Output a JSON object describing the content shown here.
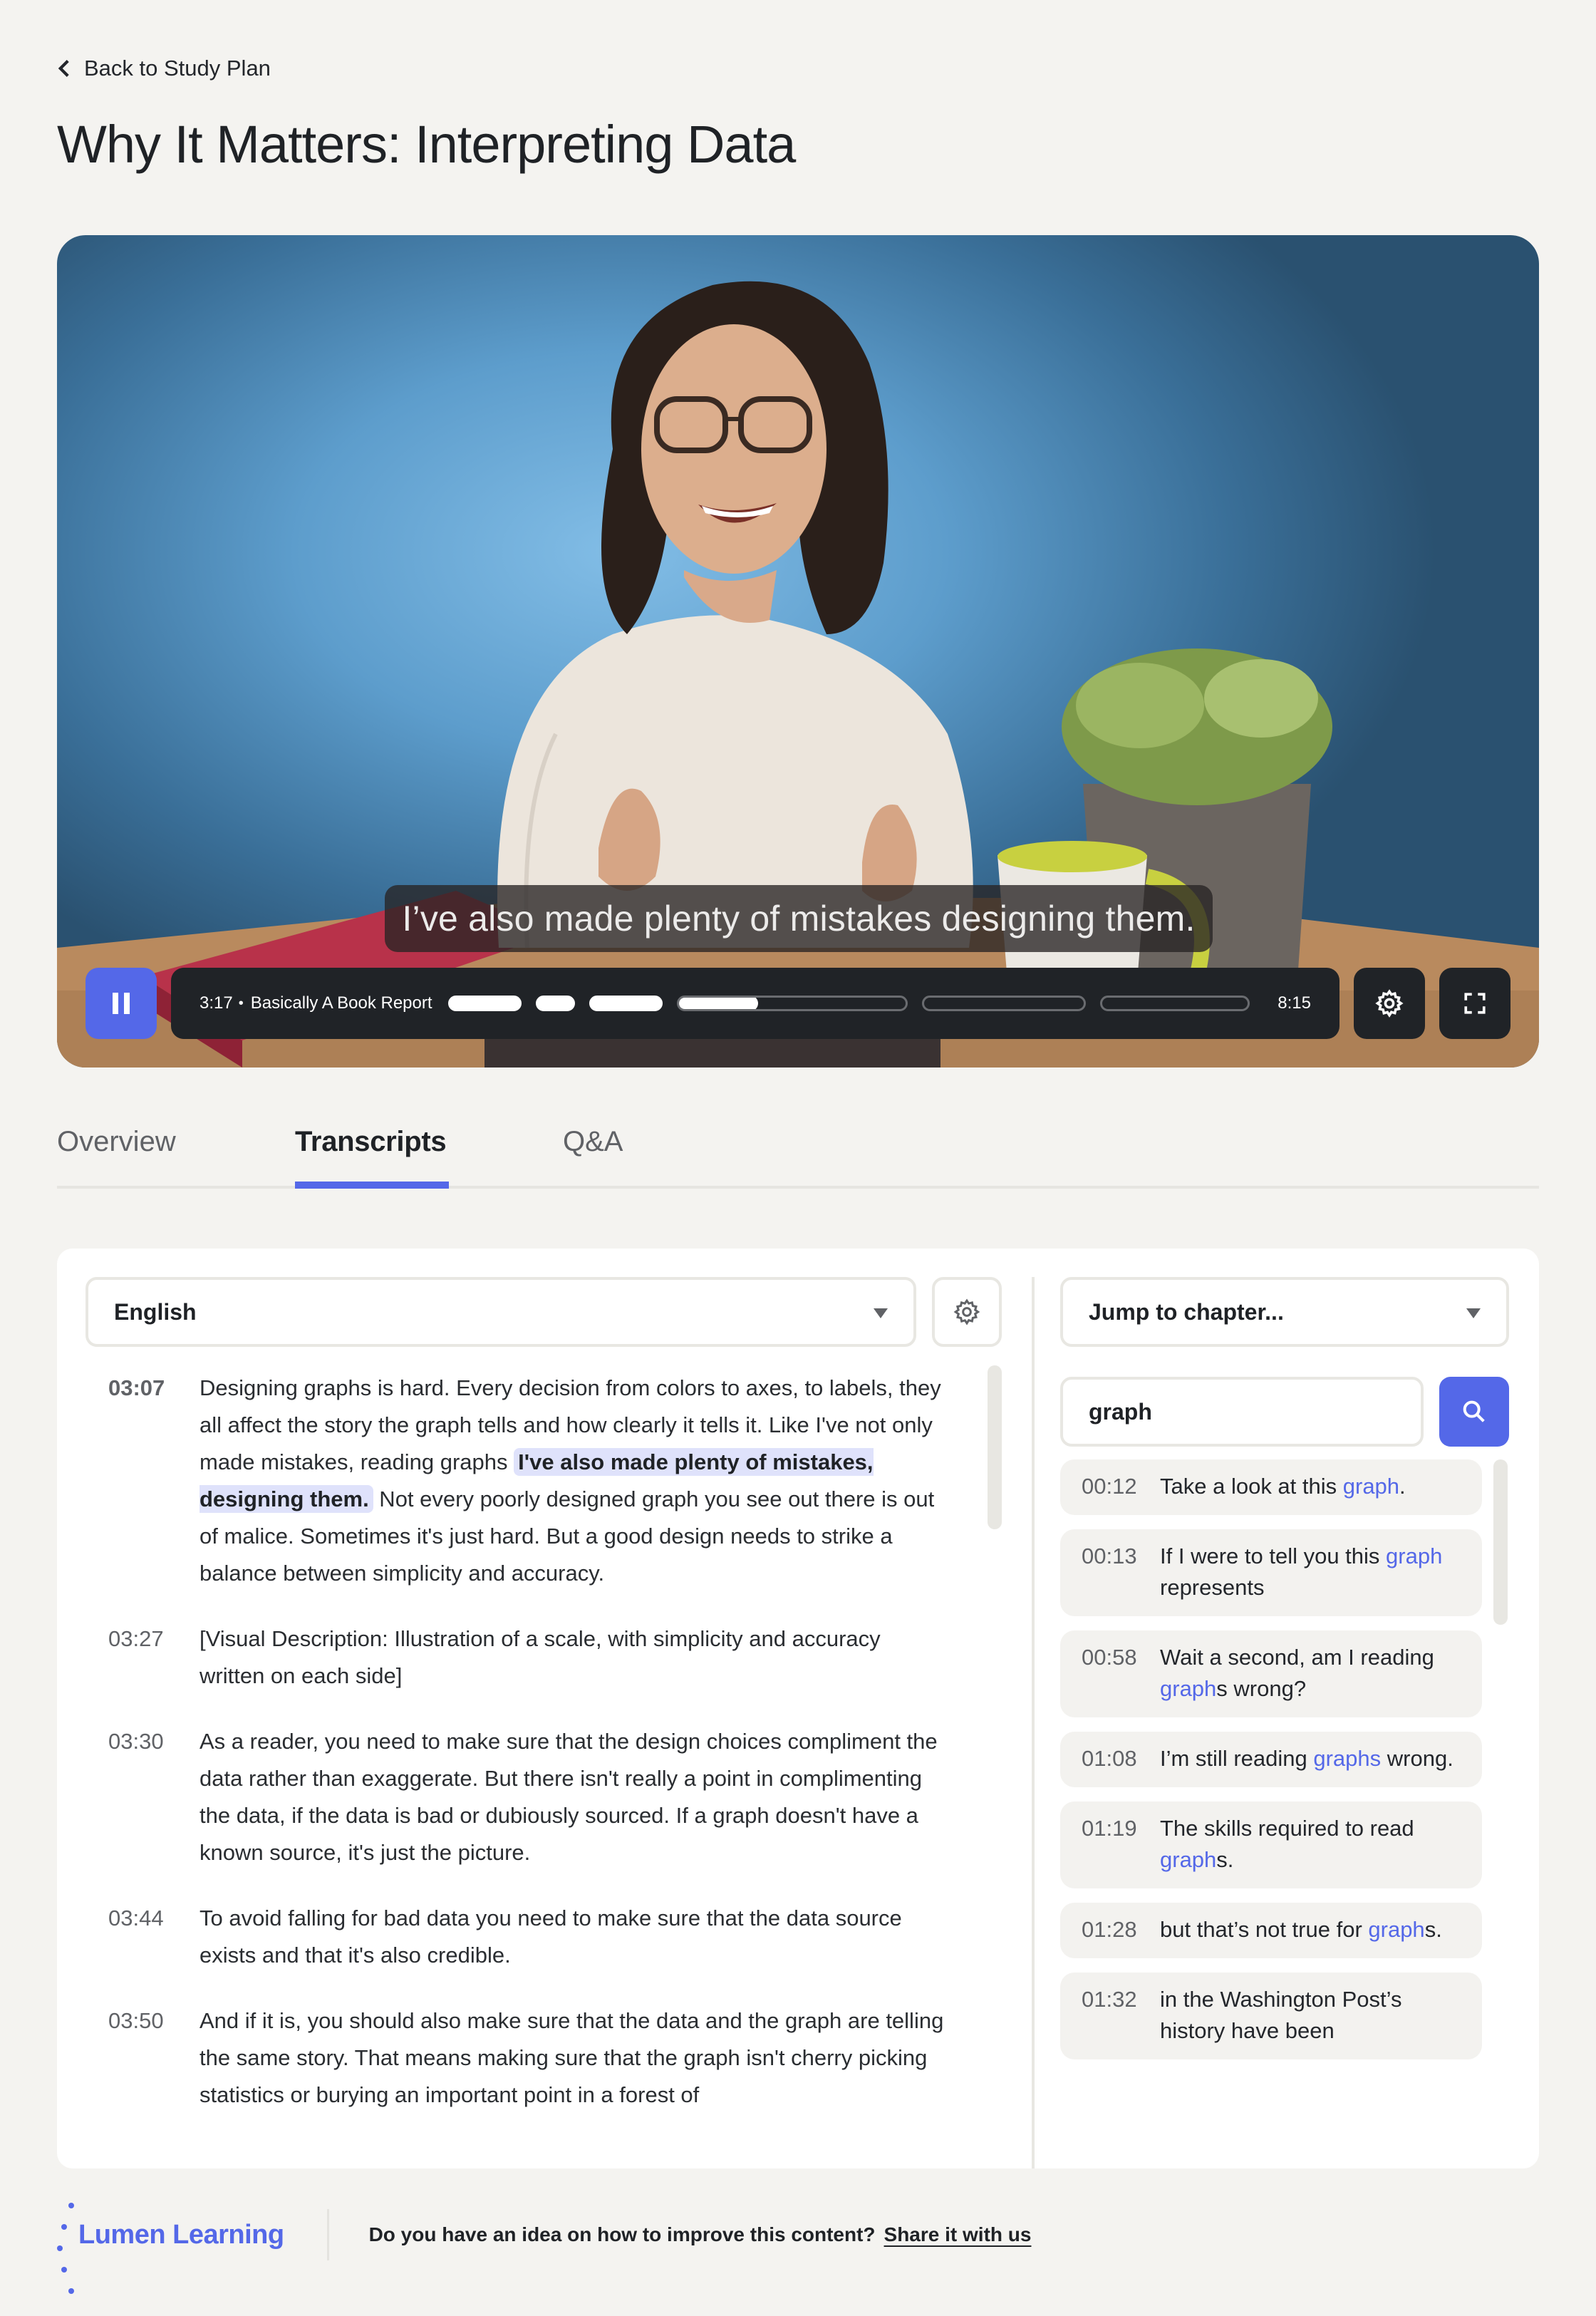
{
  "nav": {
    "back_label": "Back to Study Plan"
  },
  "page": {
    "title": "Why It Matters: Interpreting Data"
  },
  "video": {
    "caption": "I’ve also made plenty of mistakes designing them.",
    "current_time": "3:17",
    "separator": "•",
    "current_chapter": "Basically A Book Report",
    "duration": "8:15",
    "state": "playing",
    "chapters_progress": [
      1,
      1,
      1,
      0.35,
      0,
      0,
      0
    ],
    "icons": {
      "pause": "pause-icon",
      "settings": "gear-icon",
      "fullscreen": "fullscreen-icon"
    }
  },
  "tabs": [
    {
      "label": "Overview",
      "active": false
    },
    {
      "label": "Transcripts",
      "active": true
    },
    {
      "label": "Q&A",
      "active": false
    }
  ],
  "transcript": {
    "language": "English",
    "entries": [
      {
        "time": "03:07",
        "current": true,
        "before": "Designing graphs is hard. Every decision from colors to axes, to labels, they all affect the story the graph tells and how clearly it tells it. Like I've not only made mistakes, reading graphs ",
        "highlight": "I've also made plenty of mistakes, designing them.",
        "after": " Not every poorly designed graph you see out there is out of malice. Sometimes it's just hard. But a good design needs to strike a balance between simplicity and accuracy."
      },
      {
        "time": "03:27",
        "current": false,
        "before": "[Visual Description: Illustration of a scale, with simplicity and accuracy written on each side]",
        "highlight": "",
        "after": ""
      },
      {
        "time": "03:30",
        "current": false,
        "before": "As a reader, you need to make sure that the design choices compliment the data rather than exaggerate. But there isn't really a point in complimenting the data, if the data is bad or dubiously sourced. If a graph doesn't have a known source, it's just the picture.",
        "highlight": "",
        "after": ""
      },
      {
        "time": "03:44",
        "current": false,
        "before": "To avoid falling for bad data you need to make sure that the data source exists and that it's also credible.",
        "highlight": "",
        "after": ""
      },
      {
        "time": "03:50",
        "current": false,
        "before": "And if it is, you should also make sure that the data and the graph are telling the same story. That means making sure that the graph isn't cherry picking statistics or burying an important point in a forest of",
        "highlight": "",
        "after": ""
      }
    ]
  },
  "search": {
    "chapter_placeholder": "Jump to chapter...",
    "query": "graph",
    "results": [
      {
        "time": "00:12",
        "before": "Take a look at this ",
        "match": "graph",
        "after": "."
      },
      {
        "time": "00:13",
        "before": "If I were to tell you this ",
        "match": "graph",
        "after": " represents"
      },
      {
        "time": "00:58",
        "before": "Wait a second, am I reading ",
        "match": "graph",
        "after": "s wrong?"
      },
      {
        "time": "01:08",
        "before": "I’m still reading ",
        "match": "graphs",
        "after": " wrong."
      },
      {
        "time": "01:19",
        "before": "The skills required to read ",
        "match": "graph",
        "after": "s."
      },
      {
        "time": "01:28",
        "before": "but that’s not true for ",
        "match": "graph",
        "after": "s."
      },
      {
        "time": "01:32",
        "before": "in the Washington Post’s history have been",
        "match": "",
        "after": ""
      }
    ]
  },
  "footer": {
    "brand": "Lumen Learning",
    "prompt": "Do you have an idea on how to improve this content?",
    "link": "Share it with us"
  },
  "colors": {
    "accent": "#5468e8",
    "background": "#f4f3f0",
    "panel": "#ffffff",
    "control_bg": "#202327",
    "highlight_bg": "#dfe2fb",
    "result_bg": "#f3f2ef"
  }
}
